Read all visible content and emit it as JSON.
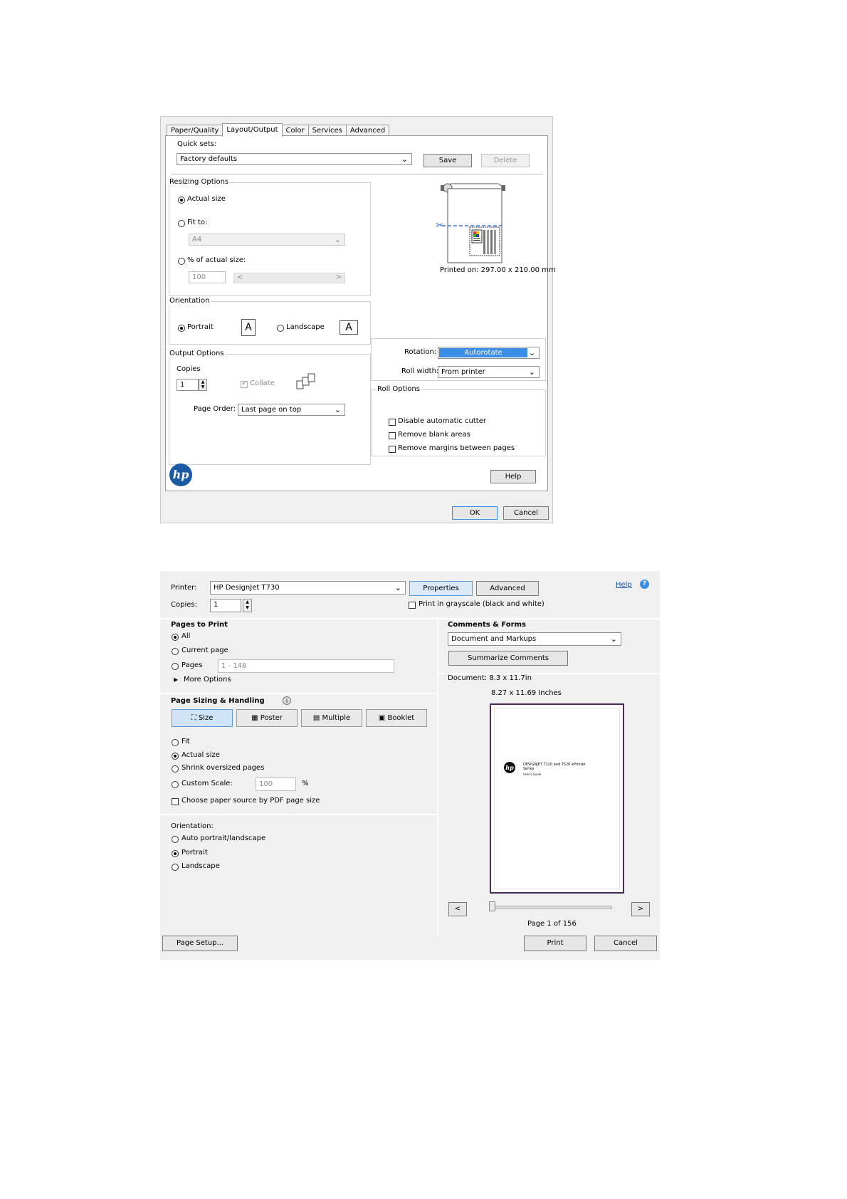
{
  "dialog1": {
    "tabs": [
      "Paper/Quality",
      "Layout/Output",
      "Color",
      "Services",
      "Advanced"
    ],
    "active_tab": "Layout/Output",
    "quick_sets": {
      "label": "Quick sets:",
      "value": "Factory defaults",
      "save": "Save",
      "delete": "Delete"
    },
    "resizing": {
      "title": "Resizing Options",
      "actual_size": "Actual size",
      "fit_to": "Fit to:",
      "fit_to_value": "A4",
      "percent": "% of actual size:",
      "percent_value": "100",
      "scroll_left": "<",
      "scroll_right": ">"
    },
    "preview_text": "Printed on: 297.00 x 210.00 mm",
    "orientation": {
      "title": "Orientation",
      "portrait": "Portrait",
      "landscape": "Landscape",
      "glyph": "A"
    },
    "rotation": {
      "label": "Rotation:",
      "value": "Autorotate"
    },
    "roll_width": {
      "label": "Roll width:",
      "value": "From printer"
    },
    "output": {
      "title": "Output Options",
      "copies_label": "Copies",
      "copies_value": "1",
      "collate": "Collate",
      "page_order_label": "Page Order:",
      "page_order_value": "Last page on top"
    },
    "roll_options": {
      "title": "Roll Options",
      "items": [
        "Disable automatic cutter",
        "Remove blank areas",
        "Remove margins between pages"
      ]
    },
    "logo_text": "hp",
    "help": "Help",
    "ok": "OK",
    "cancel": "Cancel"
  },
  "dialog2": {
    "printer_label": "Printer:",
    "printer_value": "HP DesignJet T730",
    "properties": "Properties",
    "advanced": "Advanced",
    "help": "Help",
    "copies_label": "Copies:",
    "copies_value": "1",
    "grayscale": "Print in grayscale (black and white)",
    "pages_to_print": {
      "title": "Pages to Print",
      "all": "All",
      "current": "Current page",
      "pages": "Pages",
      "pages_value": "1 - 148",
      "more": "More Options"
    },
    "sizing": {
      "title": "Page Sizing & Handling",
      "buttons": [
        "Size",
        "Poster",
        "Multiple",
        "Booklet"
      ],
      "fit": "Fit",
      "actual": "Actual size",
      "shrink": "Shrink oversized pages",
      "custom": "Custom Scale:",
      "custom_value": "100",
      "percent": "%",
      "paper_source": "Choose paper source by PDF page size"
    },
    "orientation": {
      "title": "Orientation:",
      "auto": "Auto portrait/landscape",
      "portrait": "Portrait",
      "landscape": "Landscape"
    },
    "comments": {
      "title": "Comments & Forms",
      "value": "Document and Markups",
      "summarize": "Summarize Comments"
    },
    "document": "Document: 8.3 x 11.7in",
    "page_size": "8.27 x 11.69 Inches",
    "preview": {
      "title_line1": "DESIGNJET T120 and T520 ePrinter",
      "title_line2": "Series",
      "subtitle": "User's Guide"
    },
    "prev": "<",
    "next": ">",
    "page_indicator": "Page 1 of 156",
    "page_setup": "Page Setup...",
    "print": "Print",
    "cancel": "Cancel"
  },
  "colors": {
    "accent": "#3c8de6",
    "selection": "#2f7ad8",
    "link": "#1a4fb3"
  }
}
